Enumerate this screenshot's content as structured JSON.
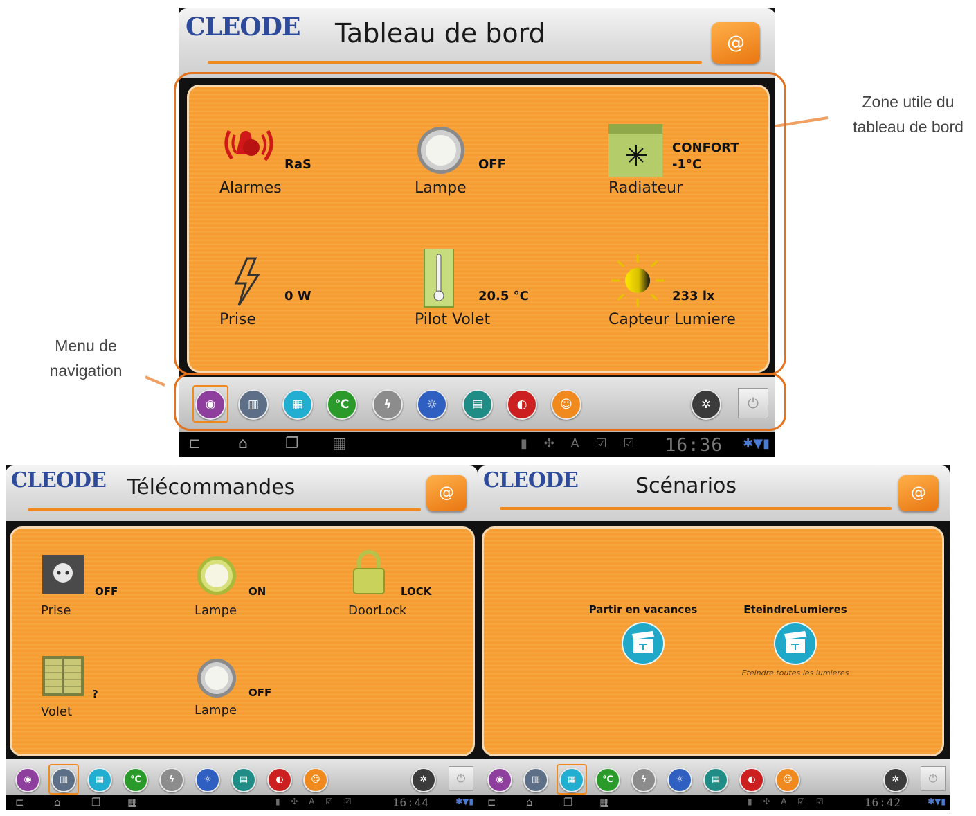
{
  "annotations": {
    "zone_label_line1": "Zone utile du",
    "zone_label_line2": "tableau de bord",
    "menu_label_line1": "Menu de",
    "menu_label_line2": "navigation",
    "accent_color": "#e4721d"
  },
  "brand": {
    "logo": "CLEODE",
    "home_icon": "house-at-icon",
    "accent": "#f08a1e"
  },
  "nav_icons": [
    {
      "name": "dashboard-eye-icon",
      "color": "#8e3f9e",
      "glyph": "◉"
    },
    {
      "name": "remote-control-icon",
      "color": "#5d6f86",
      "glyph": "▥"
    },
    {
      "name": "scenario-clapper-icon",
      "color": "#22aed1",
      "glyph": "▦"
    },
    {
      "name": "thermometer-icon",
      "color": "#2a9a2a",
      "glyph": "℃"
    },
    {
      "name": "energy-bolt-icon",
      "color": "#8c8c8c",
      "glyph": "ϟ"
    },
    {
      "name": "light-bulb-icon",
      "color": "#2f5fc0",
      "glyph": "☼"
    },
    {
      "name": "shutter-icon",
      "color": "#1f8d86",
      "glyph": "▤"
    },
    {
      "name": "alarm-icon",
      "color": "#cc1f1f",
      "glyph": "◐"
    },
    {
      "name": "presence-person-icon",
      "color": "#f08a1e",
      "glyph": "☺"
    },
    {
      "name": "settings-gears-icon",
      "color": "#3b3b3b",
      "glyph": "✲"
    }
  ],
  "dashboard": {
    "title": "Tableau de bord",
    "clock": "16:36",
    "devices": [
      {
        "label": "Alarmes",
        "state": "RaS",
        "icon": "alarm-siren-icon"
      },
      {
        "label": "Lampe",
        "state": "OFF",
        "icon": "lamp-off-icon"
      },
      {
        "label": "Radiateur",
        "state_line1": "CONFORT",
        "state_line2": "-1°C",
        "icon": "radiator-icon"
      },
      {
        "label": "Prise",
        "state": "0 W",
        "icon": "power-bolt-icon"
      },
      {
        "label": "Pilot Volet",
        "state": "20.5 °C",
        "icon": "thermometer-icon"
      },
      {
        "label": "Capteur Lumiere",
        "state": "233 lx",
        "icon": "sun-icon"
      }
    ]
  },
  "remotes": {
    "title": "Télécommandes",
    "clock": "16:44",
    "devices": [
      {
        "label": "Prise",
        "state": "OFF",
        "icon": "socket-icon"
      },
      {
        "label": "Lampe",
        "state": "ON",
        "icon": "lamp-on-icon"
      },
      {
        "label": "DoorLock",
        "state": "LOCK",
        "icon": "padlock-icon"
      },
      {
        "label": "Volet",
        "state": "?",
        "icon": "shutter-window-icon"
      },
      {
        "label": "Lampe",
        "state": "OFF",
        "icon": "lamp-off-icon"
      }
    ]
  },
  "scenarios": {
    "title": "Scénarios",
    "clock": "16:42",
    "items": [
      {
        "name": "Partir en vacances",
        "description": "",
        "icon": "clapper-icon"
      },
      {
        "name": "EteindreLumieres",
        "description": "Eteindre toutes les lumieres",
        "icon": "clapper-icon"
      }
    ]
  }
}
